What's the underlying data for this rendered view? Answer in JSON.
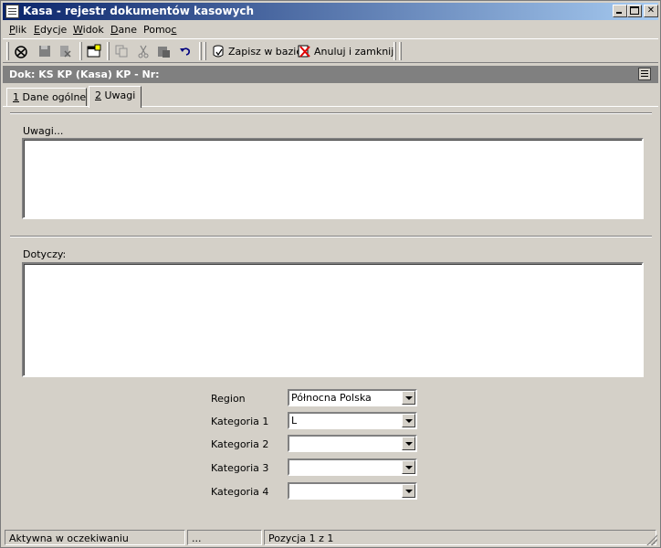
{
  "window": {
    "title": "Kasa - rejestr dokumentów kasowych"
  },
  "menu": [
    {
      "label": "Plik",
      "acc": "P",
      "rest": "lik"
    },
    {
      "label": "Edycje",
      "acc": "E",
      "rest": "dycje"
    },
    {
      "label": "Widok",
      "acc": "W",
      "rest": "idok"
    },
    {
      "label": "Dane",
      "acc": "D",
      "rest": "ane"
    },
    {
      "label": "Pomoc",
      "pre": "Pomo",
      "acc": "c"
    }
  ],
  "toolbar": {
    "save_label": "Zapisz w bazie",
    "cancel_label": "Anuluj i zamknij"
  },
  "document": {
    "header": "Dok: KS KP (Kasa)  KP  -  Nr:"
  },
  "tabs": [
    {
      "num": "1",
      "label": " Dane ogólne"
    },
    {
      "num": "2",
      "label": " Uwagi"
    }
  ],
  "form": {
    "uwagi_label": "Uwagi...",
    "uwagi_value": "",
    "dotyczy_label": "Dotyczy:",
    "dotyczy_value": "",
    "fields": [
      {
        "label": "Region",
        "value": "Północna Polska"
      },
      {
        "label": "Kategoria 1",
        "value": "L"
      },
      {
        "label": "Kategoria 2",
        "value": ""
      },
      {
        "label": "Kategoria 3",
        "value": ""
      },
      {
        "label": "Kategoria 4",
        "value": ""
      }
    ]
  },
  "status": {
    "state": "Aktywna w oczekiwaniu",
    "middle": "...",
    "position": "Pozycja 1 z 1"
  },
  "icons": {
    "app": "document-list-icon",
    "colors": {
      "title_start": "#0a246a",
      "title_end": "#a6caf0",
      "doc_header": "#808080"
    }
  }
}
